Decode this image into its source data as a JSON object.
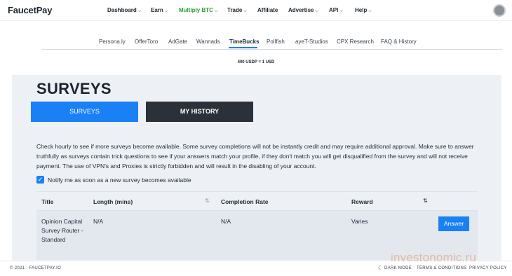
{
  "brand": {
    "name_a": "Faucet",
    "name_b": "Pay"
  },
  "nav": [
    {
      "label": "Dashboard",
      "dropdown": true
    },
    {
      "label": "Earn",
      "dropdown": true
    },
    {
      "label": "Multiply BTC",
      "dropdown": true
    },
    {
      "label": "Trade",
      "dropdown": true
    },
    {
      "label": "Affiliate",
      "dropdown": false
    },
    {
      "label": "Advertise",
      "dropdown": true
    },
    {
      "label": "API",
      "dropdown": true
    },
    {
      "label": "Help",
      "dropdown": true
    }
  ],
  "providers": [
    "Persona.ly",
    "OfferToro",
    "AdGate",
    "Wannads",
    "TimeBucks",
    "Pollfish",
    "ayeT-Studios",
    "CPX Research",
    "FAQ & History"
  ],
  "active_provider": "TimeBucks",
  "rate": "400 USDP = 1 USD",
  "page": {
    "title": "SURVEYS",
    "tab_surveys": "SURVEYS",
    "tab_history": "MY HISTORY",
    "description": "Check hourly to see if more surveys become available. Some survey completions will not be instantly credit and may require additional approval. Make sure to answer truthfully as surveys contain trick questions to see if your answers match your profile, if they don't match you will get disqualified from the survey and will not receive payment. The use of VPN's and Proxies is strictly forbidden and will result in the disabling of your account.",
    "notify_label": "Notify me as soon as a new survey becomes available",
    "notify_checked": true
  },
  "table": {
    "headers": [
      "Title",
      "Length (mins)",
      "Completion Rate",
      "Reward"
    ],
    "rows": [
      {
        "title": "Opinion Capital Survey Router - Standard",
        "length": "N/A",
        "completion": "N/A",
        "reward": "Varies",
        "action": "Answer"
      }
    ]
  },
  "footer": {
    "copyright": "© 2021 - FAUCETPAY.IO",
    "dark_mode": "DARK MODE",
    "terms": "TERMS & CONDITIONS",
    "privacy": "PRIVACY POLICY"
  },
  "watermark": "investonomic.ru",
  "colors": {
    "accent": "#1a80f5",
    "dark_button": "#2b3138",
    "multiply_green": "#2e9a36"
  },
  "icons": {
    "chevron": "chevron-down-icon",
    "sort": "sort-icon",
    "check": "check-icon",
    "moon": "moon-icon"
  }
}
